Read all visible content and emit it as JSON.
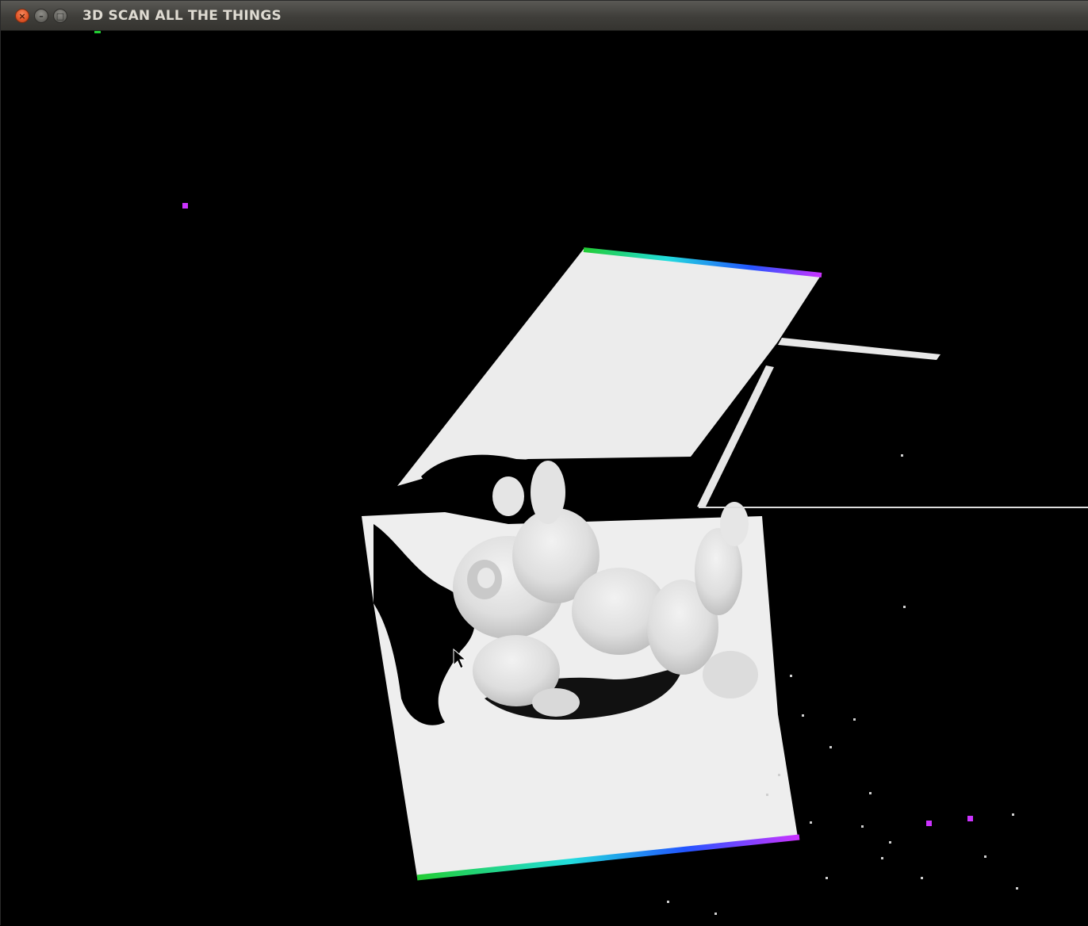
{
  "window": {
    "title": "3D SCAN ALL THE THINGS",
    "buttons": {
      "close_glyph": "×",
      "minimize_glyph": "–",
      "maximize_glyph": "□"
    }
  },
  "viewport": {
    "background": "#000000",
    "scan_color": "#efefef",
    "edge_gradient": [
      "#22cc33",
      "#22dddd",
      "#2255ff",
      "#cc33ff"
    ],
    "marker_color": "#cc33ff"
  }
}
